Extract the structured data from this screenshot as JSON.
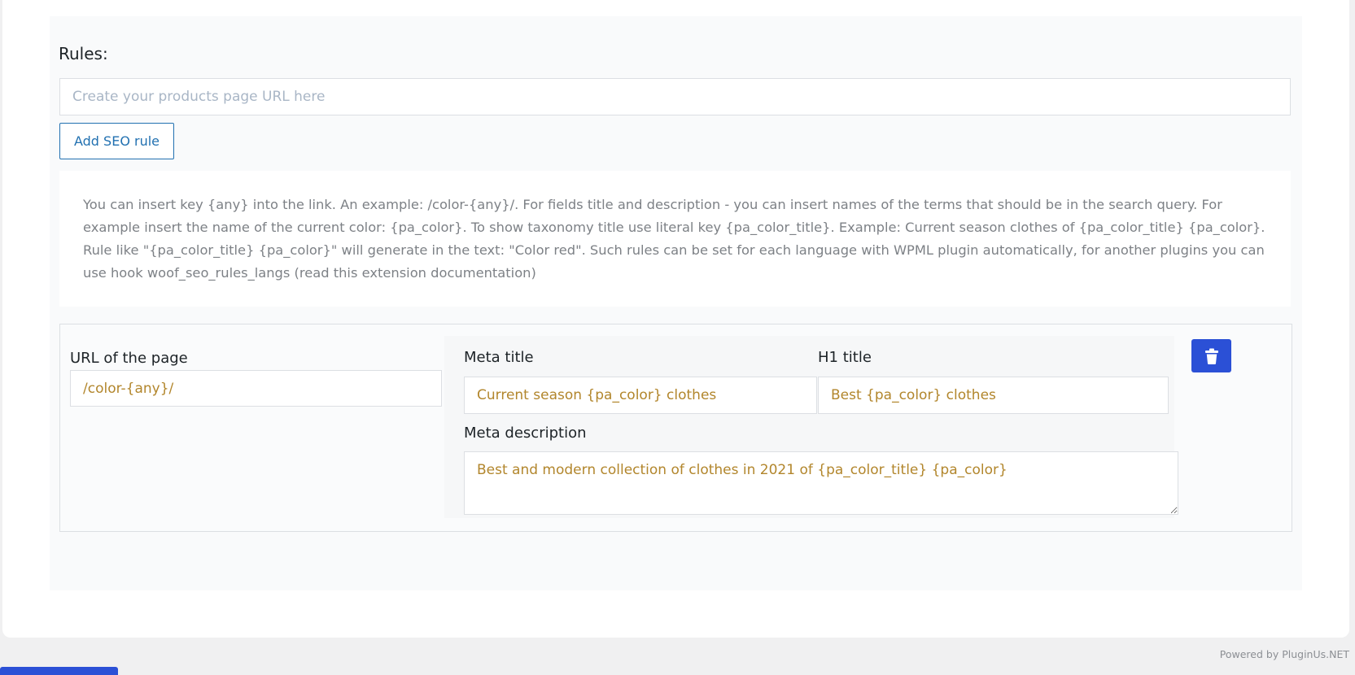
{
  "rules_section": {
    "label": "Rules:",
    "url_input_placeholder": "Create your products page URL here",
    "url_input_value": "",
    "add_button_label": "Add SEO rule",
    "info_text": "You can insert key {any} into the link. An example: /color-{any}/. For fields title and description - you can insert names of the terms that should be in the search query. For example insert the name of the current color: {pa_color}. To show taxonomy title use literal key {pa_color_title}. Example: Current season clothes of {pa_color_title} {pa_color}. Rule like \"{pa_color_title} {pa_color}\" will generate in the text: \"Color red\". Such rules can be set for each language with WPML plugin automatically, for another plugins you can use hook woof_seo_rules_langs (read this extension documentation)"
  },
  "rule": {
    "url_label": "URL of the page",
    "url_value": "/color-{any}/",
    "meta_title_label": "Meta title",
    "meta_title_value": "Current season {pa_color} clothes",
    "h1_title_label": "H1 title",
    "h1_title_value": "Best {pa_color} clothes",
    "meta_description_label": "Meta description",
    "meta_description_value": "Best and modern collection of clothes in 2021 of {pa_color_title} {pa_color}",
    "delete_icon": "trash-icon"
  },
  "footer": {
    "powered_by": "Powered by PluginUs.NET"
  },
  "colors": {
    "accent": "#2b50d6",
    "link_blue": "#2271b1",
    "value_text": "#b2862c"
  }
}
